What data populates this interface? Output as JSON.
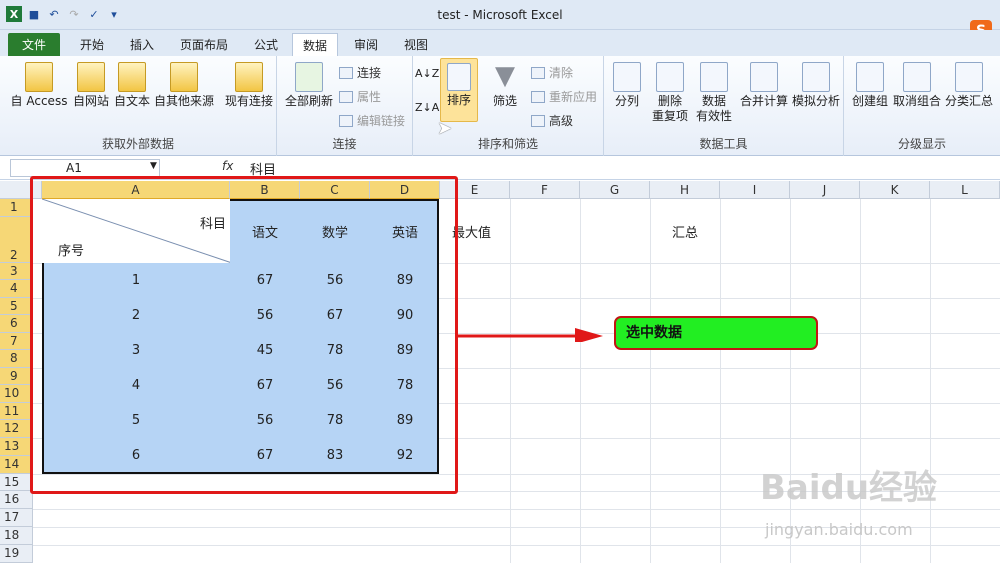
{
  "window": {
    "title": "test - Microsoft Excel"
  },
  "tabs": [
    "文件",
    "开始",
    "插入",
    "页面布局",
    "公式",
    "数据",
    "审阅",
    "视图"
  ],
  "ribbon": {
    "get_external": {
      "label": "获取外部数据",
      "buttons": [
        "自 Access",
        "自网站",
        "自文本",
        "自其他来源",
        "现有连接"
      ]
    },
    "connections": {
      "label": "连接",
      "main": "全部刷新",
      "small": [
        "连接",
        "属性",
        "编辑链接"
      ]
    },
    "sort_filter": {
      "label": "排序和筛选",
      "sort": "排序",
      "filter": "筛选",
      "small": [
        "清除",
        "重新应用",
        "高级"
      ]
    },
    "data_tools": {
      "label": "数据工具",
      "buttons": [
        "分列",
        "删除\n重复项",
        "数据\n有效性",
        "合并计算",
        "模拟分析"
      ]
    },
    "outline": {
      "label": "分级显示",
      "buttons": [
        "创建组",
        "取消组合",
        "分类汇总"
      ]
    }
  },
  "formula_bar": {
    "name_box": "A1",
    "fx": "fx",
    "value": "科目"
  },
  "columns": [
    "A",
    "B",
    "C",
    "D",
    "E",
    "F",
    "G",
    "H",
    "I",
    "J",
    "K",
    "L"
  ],
  "rows": [
    "1",
    "2",
    "3",
    "4",
    "5",
    "6",
    "7",
    "8",
    "9",
    "10",
    "11",
    "12",
    "13",
    "14",
    "15",
    "16",
    "17",
    "18",
    "19"
  ],
  "table": {
    "header_top": "科目",
    "header_bottom": "序号",
    "subjects": [
      "语文",
      "数学",
      "英语"
    ],
    "rows": [
      {
        "id": "1",
        "values": [
          "67",
          "56",
          "89"
        ]
      },
      {
        "id": "2",
        "values": [
          "56",
          "67",
          "90"
        ]
      },
      {
        "id": "3",
        "values": [
          "45",
          "78",
          "89"
        ]
      },
      {
        "id": "4",
        "values": [
          "67",
          "56",
          "78"
        ]
      },
      {
        "id": "5",
        "values": [
          "56",
          "78",
          "89"
        ]
      },
      {
        "id": "6",
        "values": [
          "67",
          "83",
          "92"
        ]
      }
    ]
  },
  "other_cells": {
    "e1": "最大值",
    "h1": "汇总"
  },
  "annotation": {
    "callout": "选中数据",
    "color": "#22ee22",
    "border": "#e01818"
  },
  "watermark": {
    "main": "Baidu经验",
    "sub": "jingyan.baidu.com"
  }
}
